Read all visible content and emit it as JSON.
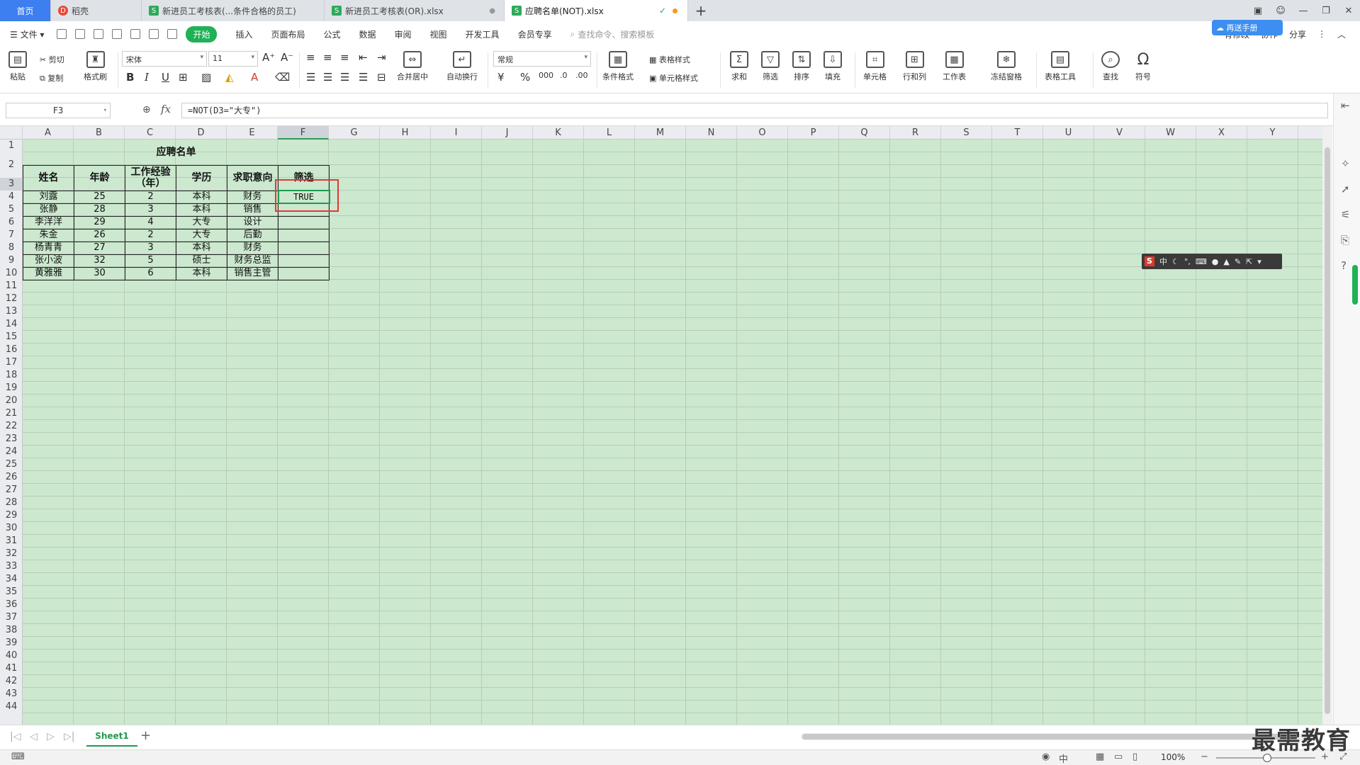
{
  "tabs": {
    "home": "首页",
    "docer": "稻壳",
    "file1": "新进员工考核表(...条件合格的员工)",
    "file2": "新进员工考核表(OR).xlsx",
    "active": "应聘名单(NOT).xlsx"
  },
  "menu": {
    "file": "文件",
    "items": [
      "开始",
      "插入",
      "页面布局",
      "公式",
      "数据",
      "审阅",
      "视图",
      "开发工具",
      "会员专享"
    ],
    "search_placeholder": "查找命令、搜索模板",
    "right": [
      "有修改",
      "协作",
      "分享"
    ],
    "badge": "再送手册"
  },
  "ribbon": {
    "paste": "粘贴",
    "cut": "剪切",
    "copy": "复制",
    "format_painter": "格式刷",
    "font": "宋体",
    "font_size": "11",
    "merge": "合并居中",
    "wrap": "自动换行",
    "number_format": "常规",
    "cond_format": "条件格式",
    "table_style": "表格样式",
    "cell_style": "单元格样式",
    "sum": "求和",
    "filter": "筛选",
    "sort": "排序",
    "fill": "填充",
    "cell": "单元格",
    "rowcol": "行和列",
    "sheet": "工作表",
    "freeze": "冻结窗格",
    "table_tools": "表格工具",
    "find": "查找",
    "symbol": "符号"
  },
  "formula_bar": {
    "name_box": "F3",
    "fx": "fx",
    "formula": "=NOT(D3=\"大专\")"
  },
  "columns": [
    "A",
    "B",
    "C",
    "D",
    "E",
    "F",
    "G",
    "H",
    "I",
    "J",
    "K",
    "L",
    "M",
    "N",
    "O",
    "P",
    "Q",
    "R",
    "S",
    "T",
    "U",
    "V",
    "W",
    "X",
    "Y"
  ],
  "rows": [
    "1",
    "2",
    "3",
    "4",
    "5",
    "6",
    "7",
    "8",
    "9",
    "10",
    "11",
    "12",
    "13",
    "14",
    "15",
    "16",
    "17",
    "18",
    "19",
    "20",
    "21",
    "22",
    "23",
    "24",
    "25",
    "26",
    "27",
    "28",
    "29",
    "30",
    "31",
    "32",
    "33",
    "34",
    "35",
    "36",
    "37",
    "38",
    "39",
    "40",
    "41",
    "42",
    "43",
    "44"
  ],
  "table": {
    "title": "应聘名单",
    "headers": [
      "姓名",
      "年龄",
      "工作经验（年）",
      "学历",
      "求职意向",
      "筛选"
    ],
    "rows": [
      [
        "刘露",
        "25",
        "2",
        "本科",
        "财务",
        "TRUE"
      ],
      [
        "张静",
        "28",
        "3",
        "本科",
        "销售",
        ""
      ],
      [
        "李洋洋",
        "29",
        "4",
        "大专",
        "设计",
        ""
      ],
      [
        "朱金",
        "26",
        "2",
        "大专",
        "后勤",
        ""
      ],
      [
        "杨青青",
        "27",
        "3",
        "本科",
        "财务",
        ""
      ],
      [
        "张小波",
        "32",
        "5",
        "硕士",
        "财务总监",
        ""
      ],
      [
        "黄雅雅",
        "30",
        "6",
        "本科",
        "销售主管",
        ""
      ]
    ]
  },
  "ime": {
    "lang": "中"
  },
  "sheet_tab": "Sheet1",
  "status": {
    "zoom": "100%"
  },
  "watermark": "最需教育"
}
